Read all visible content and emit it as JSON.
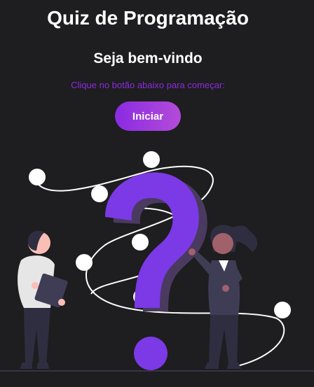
{
  "header": {
    "title": "Quiz de Programação"
  },
  "welcome": {
    "heading": "Seja bem-vindo",
    "instruction": "Clique no botão abaixo para começar:"
  },
  "actions": {
    "start_label": "Iniciar"
  },
  "colors": {
    "background": "#1e1d1f",
    "accent": "#8a2be2",
    "question_mark": "#7b3ae6",
    "text": "#ffffff"
  },
  "illustration": {
    "icon": "question-mark-people-illustration"
  }
}
